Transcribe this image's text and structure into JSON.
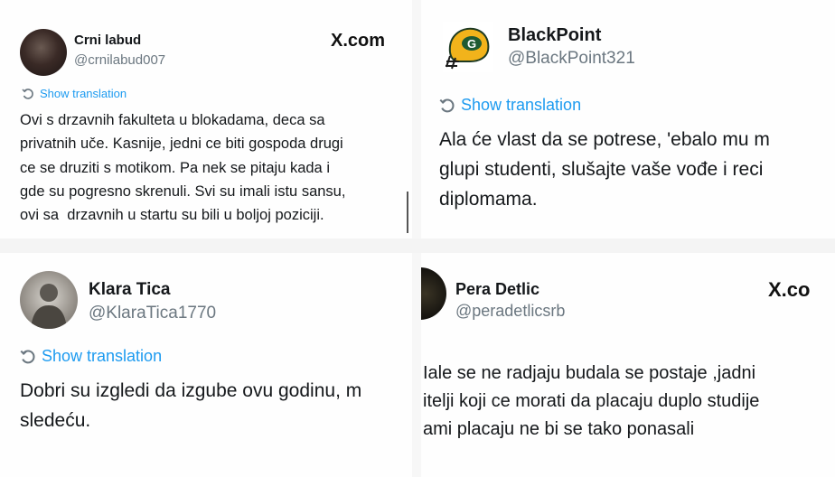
{
  "tweets": [
    {
      "author": "Crni labud",
      "handle": "@crnilabud007",
      "source": "X.com",
      "show_translation": "Show translation",
      "text": "Ovi s drzavnih fakulteta u blokadama, deca sa\nprivatnih uče. Kasnije, jedni ce biti gospoda drugi\nce se druziti s motikom. Pa nek se pitaju kada i\ngde su pogresno skrenuli. Svi su imali istu sansu,\novi sa  drzavnih u startu su bili u boljoj poziciji."
    },
    {
      "author": "BlackPoint",
      "handle": "@BlackPoint321",
      "show_translation": "Show translation",
      "text": "Ala će vlast da se potrese, 'ebalo mu m\nglupi studenti, slušajte vaše vođe i reci\ndiplomama."
    },
    {
      "author": "Klara Tica",
      "handle": "@KlaraTica1770",
      "show_translation": "Show translation",
      "text": "Dobri su izgledi da izgube ovu godinu, m\nsledeću."
    },
    {
      "author": "Pera Detlic",
      "handle": "@peradetlicsrb",
      "source": "X.co",
      "text": "Iale se ne radjaju budala se postaje ,jadni\nitelji koji ce morati da placaju duplo studije\nami placaju ne bi se tako ponasali"
    }
  ],
  "icons": {
    "translate": "translate-icon",
    "avatar_2": "green-bay-helmet-icon"
  },
  "colors": {
    "link": "#1d9bf0",
    "handle": "#6b7780",
    "text": "#15181b"
  }
}
